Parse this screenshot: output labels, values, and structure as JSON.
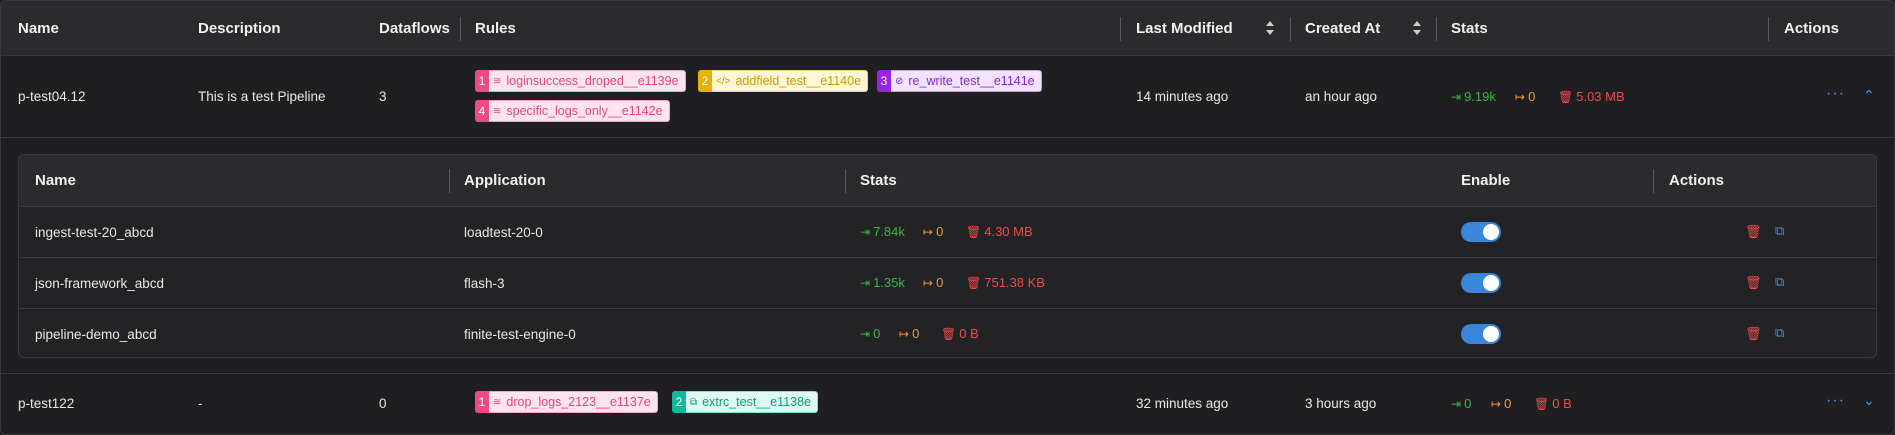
{
  "header": {
    "columns": {
      "name": "Name",
      "description": "Description",
      "dataflows": "Dataflows",
      "rules": "Rules",
      "last_modified": "Last Modified",
      "created_at": "Created At",
      "stats": "Stats",
      "actions": "Actions"
    }
  },
  "pipelines": [
    {
      "name": "p-test04.12",
      "description": "This is a test Pipeline",
      "dataflows": "3",
      "rules": [
        {
          "num": "1",
          "icon": "≋",
          "label": "loginsuccess_droped__e1139e",
          "color": "pink"
        },
        {
          "num": "2",
          "icon": "</>",
          "label": "addfield_test__e1140e",
          "color": "yellow"
        },
        {
          "num": "3",
          "icon": "⊘",
          "label": "re_write_test__e1141e",
          "color": "purple"
        },
        {
          "num": "4",
          "icon": "≋",
          "label": "specific_logs_only__e1142e",
          "color": "pink"
        }
      ],
      "last_modified": "14 minutes ago",
      "created_at": "an hour ago",
      "stats": {
        "in": "9.19k",
        "out": "0",
        "size": "5.03 MB"
      },
      "actions": "···",
      "expanded": true
    },
    {
      "name": "p-test122",
      "description": "-",
      "dataflows": "0",
      "rules": [
        {
          "num": "1",
          "icon": "≋",
          "label": "drop_logs_2123__e1137e",
          "color": "pink"
        },
        {
          "num": "2",
          "icon": "⧉",
          "label": "extrc_test__e1138e",
          "color": "teal"
        }
      ],
      "last_modified": "32 minutes ago",
      "created_at": "3 hours ago",
      "stats": {
        "in": "0",
        "out": "0",
        "size": "0 B"
      },
      "actions": "···",
      "expanded": false
    }
  ],
  "dataflows_table": {
    "columns": {
      "name": "Name",
      "application": "Application",
      "stats": "Stats",
      "enable": "Enable",
      "actions": "Actions"
    },
    "rows": [
      {
        "name": "ingest-test-20_abcd",
        "application": "loadtest-20-0",
        "stats": {
          "in": "7.84k",
          "out": "0",
          "size": "4.30 MB"
        },
        "enabled": true
      },
      {
        "name": "json-framework_abcd",
        "application": "flash-3",
        "stats": {
          "in": "1.35k",
          "out": "0",
          "size": "751.38 KB"
        },
        "enabled": true
      },
      {
        "name": "pipeline-demo_abcd",
        "application": "finite-test-engine-0",
        "stats": {
          "in": "0",
          "out": "0",
          "size": "0 B"
        },
        "enabled": true
      }
    ]
  },
  "icons": {
    "stat_in": "sign-in-icon",
    "stat_out": "sign-out-icon",
    "stat_size": "trash-icon",
    "expand": "chevron-up-icon",
    "collapse": "chevron-down-icon",
    "open": "external-link-icon"
  }
}
